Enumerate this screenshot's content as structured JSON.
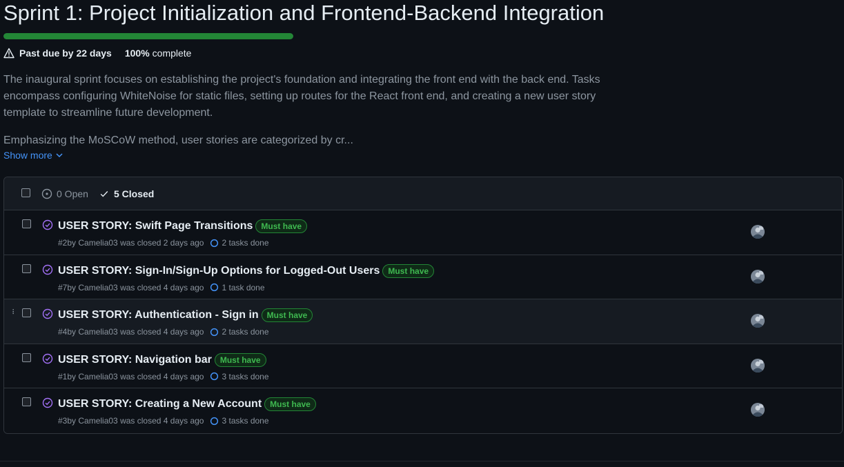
{
  "milestone": {
    "title": "Sprint 1: Project Initialization and Frontend-Backend Integration",
    "progress_percent": 100,
    "past_due": "Past due by 22 days",
    "percent_label": "100%",
    "complete_word": "complete",
    "description_p1": "The inaugural sprint focuses on establishing the project's foundation and integrating the front end with the back end. Tasks encompass configuring WhiteNoise for static files, setting up routes for the React front end, and creating a new user story template to streamline future development.",
    "description_p2": "Emphasizing the MoSCoW method, user stories are categorized by cr...",
    "show_more": "Show more"
  },
  "list": {
    "open_label": "0 Open",
    "closed_label": "5 Closed",
    "issues": [
      {
        "title": "USER STORY: Swift Page Transitions",
        "label": "Must have",
        "number": "#2",
        "meta": " by Camelia03 was closed 2 days ago",
        "tasks": "2 tasks done"
      },
      {
        "title": "USER STORY: Sign-In/Sign-Up Options for Logged-Out Users",
        "label": "Must have",
        "number": "#7",
        "meta": " by Camelia03 was closed 4 days ago",
        "tasks": "1 task done"
      },
      {
        "title": "USER STORY: Authentication - Sign in",
        "label": "Must have",
        "number": "#4",
        "meta": " by Camelia03 was closed 4 days ago",
        "tasks": "2 tasks done"
      },
      {
        "title": "USER STORY: Navigation bar",
        "label": "Must have",
        "number": "#1",
        "meta": " by Camelia03 was closed 4 days ago",
        "tasks": "3 tasks done"
      },
      {
        "title": "USER STORY: Creating a New Account",
        "label": "Must have",
        "number": "#3",
        "meta": " by Camelia03 was closed 4 days ago",
        "tasks": "3 tasks done"
      }
    ]
  },
  "colors": {
    "background": "#0d1117",
    "progress_green": "#238636",
    "label_green": "#3fb950",
    "closed_purple": "#a371f7",
    "link_blue": "#4493f8"
  },
  "icons": {
    "warning": "alert-triangle-icon",
    "open": "issue-opened-icon",
    "closed_check": "check-icon",
    "closed_issue": "issue-closed-icon",
    "tasks": "task-progress-icon",
    "show_more": "chevron-down-icon"
  }
}
